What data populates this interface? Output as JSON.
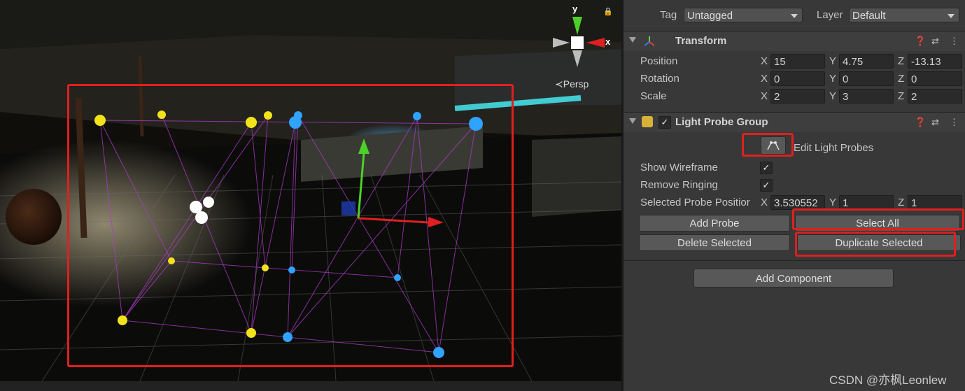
{
  "scene": {
    "projection_label": "≺Persp",
    "gizmo_y": "y",
    "gizmo_x": "x",
    "lock_icon": "lock-icon"
  },
  "inspector": {
    "tag_label": "Tag",
    "tag_value": "Untagged",
    "layer_label": "Layer",
    "layer_value": "Default",
    "transform": {
      "title": "Transform",
      "position": {
        "label": "Position",
        "x": "15",
        "y": "4.75",
        "z": "-13.13"
      },
      "rotation": {
        "label": "Rotation",
        "x": "0",
        "y": "0",
        "z": "0"
      },
      "scale": {
        "label": "Scale",
        "x": "2",
        "y": "3",
        "z": "2"
      },
      "axis_x": "X",
      "axis_y": "Y",
      "axis_z": "Z"
    },
    "light_probe_group": {
      "title": "Light Probe Group",
      "edit_label": "Edit Light Probes",
      "show_wireframe": "Show Wireframe",
      "remove_ringing": "Remove Ringing",
      "selected_probe_position": "Selected Probe Positior",
      "sel_x": "3.530552",
      "sel_y": "1",
      "sel_z": "1",
      "add_probe": "Add Probe",
      "select_all": "Select All",
      "delete_selected": "Delete Selected",
      "duplicate_selected": "Duplicate Selected"
    },
    "add_component": "Add Component"
  },
  "watermark": "CSDN @亦枫Leonlew",
  "colors": {
    "highlight_red": "#e01f1f",
    "probe_yellow": "#f2e21a",
    "probe_blue": "#2fa3ff",
    "wire_magenta": "#b03cc8"
  }
}
